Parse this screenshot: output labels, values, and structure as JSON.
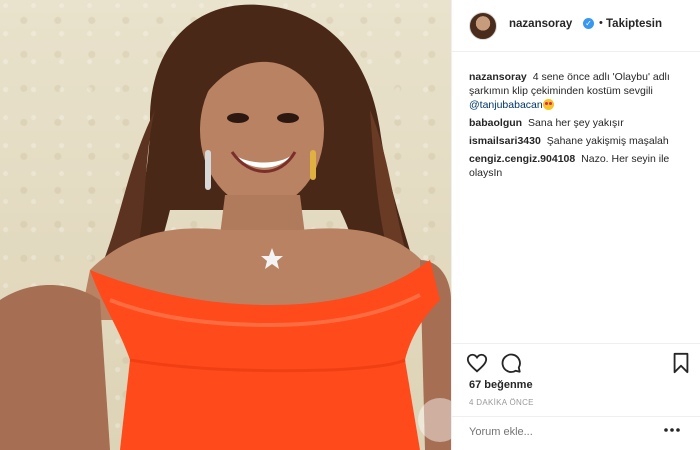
{
  "post": {
    "username": "nazansoray",
    "follow_status": "Takiptesin",
    "caption_user": "nazansoray",
    "caption_text": "4 sene önce adlı 'Olaybu' adlı şarkımın klip çekiminden kostüm sevgili",
    "caption_mention": "@tanjubabacan",
    "likes": "67 beğenme",
    "timestamp": "4 DAKİKA ÖNCE",
    "add_comment_placeholder": "Yorum ekle..."
  },
  "comments": [
    {
      "user": "babaolgun",
      "text": "Sana her şey yakışır"
    },
    {
      "user": "ismailsari3430",
      "text": "Şahane yakişmiş maşalah"
    },
    {
      "user": "cengiz.cengiz.904108",
      "text": "Nazo. Her seyin ile olaysIn"
    }
  ],
  "icons": {
    "verified": "verified-badge-icon",
    "like": "heart-icon",
    "comment": "comment-bubble-icon",
    "save": "bookmark-icon"
  },
  "colors": {
    "dress": "#ff4a1c",
    "verified": "#3897f0",
    "link": "#003569"
  }
}
